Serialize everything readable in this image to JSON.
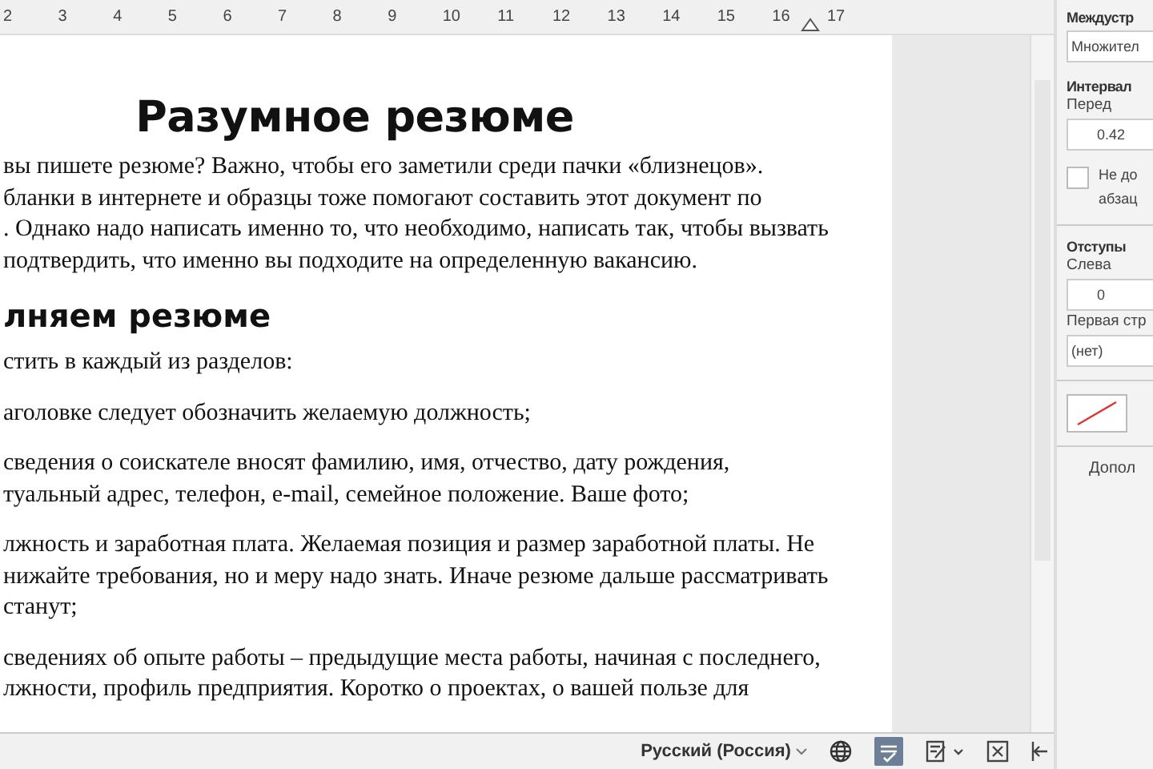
{
  "ruler": {
    "marks": [
      "2",
      "3",
      "4",
      "5",
      "6",
      "7",
      "8",
      "9",
      "10",
      "11",
      "12",
      "13",
      "14",
      "15",
      "16",
      "17"
    ]
  },
  "document": {
    "title": "Разумное резюме",
    "blocks": [
      {
        "kind": "para",
        "lines": [
          "вы пишете резюме? Важно, чтобы его заметили среди пачки «близнецов».",
          "бланки в интернете и образцы тоже помогают составить этот документ по",
          ". Однако надо написать именно то, что необходимо, написать так, чтобы вызвать",
          "подтвердить, что именно вы подходите на определенную вакансию."
        ]
      },
      {
        "kind": "heading",
        "lines": [
          "лняем резюме"
        ]
      },
      {
        "kind": "para",
        "lines": [
          "стить в каждый из разделов:"
        ]
      },
      {
        "kind": "para",
        "lines": [
          "аголовке следует обозначить желаемую должность;"
        ]
      },
      {
        "kind": "para",
        "lines": [
          "сведения о соискателе вносят фамилию, имя, отчество, дату рождения,",
          "туальный адрес, телефон, e-mail, семейное положение. Ваше фото;"
        ]
      },
      {
        "kind": "para",
        "lines": [
          "лжность и заработная плата. Желаемая позиция и размер заработной платы. Не",
          "нижайте требования, но и меру надо знать. Иначе резюме дальше рассматривать",
          "станут;"
        ]
      },
      {
        "kind": "para",
        "lines": [
          "сведениях об опыте работы – предыдущие места работы, начиная с последнего,",
          "лжности, профиль предприятия. Коротко о проектах, о вашей пользе для"
        ]
      }
    ]
  },
  "panel": {
    "line_spacing": {
      "label": "Междустр",
      "value": "Множител"
    },
    "spacing": {
      "label": "Интервал",
      "before_label": "Перед",
      "before_value": "0.42"
    },
    "no_spacing": {
      "lines": [
        "Не до",
        "абзац"
      ],
      "checked": false
    },
    "indents": {
      "label": "Отступы",
      "left_label": "Слева",
      "left_value": "0",
      "first_line_label": "Первая стр",
      "first_line_value": "(нет)"
    },
    "more_button": "Допол"
  },
  "status_bar": {
    "language": "Русский (Россия)"
  }
}
